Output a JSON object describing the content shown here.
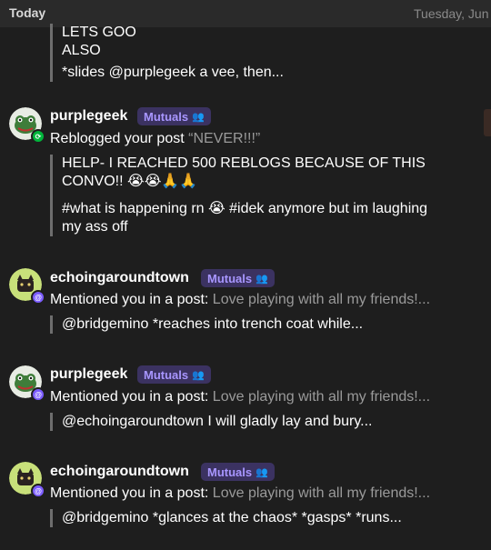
{
  "header": {
    "today_label": "Today",
    "date_label": "Tuesday, Jun"
  },
  "top_quote": {
    "lines": [
      "LETS GOO",
      "ALSO",
      "*slides @purplegeek a vee, then..."
    ]
  },
  "notifications": [
    {
      "username": "purplegeek",
      "badge": "Mutuals",
      "action": "Reblogged your post",
      "post_title": "“NEVER!!!”",
      "quote_lines": [
        "HELP- I REACHED 500 REBLOGS BECAUSE OF THIS",
        "CONVO!! 😭😭🙏🙏",
        "#what is happening rn 😭 #idek anymore but im laughing",
        "my ass off"
      ],
      "avatar_type": "reblog"
    },
    {
      "username": "echoingaroundtown",
      "badge": "Mutuals",
      "action": "Mentioned you in a post:",
      "post_title": "Love playing with all my friends!...",
      "quote_lines": [
        "@bridgemino *reaches into trench coat while..."
      ],
      "avatar_type": "mention"
    },
    {
      "username": "purplegeek",
      "badge": "Mutuals",
      "action": "Mentioned you in a post:",
      "post_title": "Love playing with all my friends!...",
      "quote_lines": [
        "@echoingaroundtown I will gladly lay and bury..."
      ],
      "avatar_type": "mention"
    },
    {
      "username": "echoingaroundtown",
      "badge": "Mutuals",
      "action": "Mentioned you in a post:",
      "post_title": "Love playing with all my friends!...",
      "quote_lines": [
        "@bridgemino *glances at the chaos* *gasps* *runs..."
      ],
      "avatar_type": "mention"
    }
  ],
  "icons": {
    "mutuals": "people-icon",
    "reblog": "reblog-icon",
    "mention": "at-icon"
  },
  "colors": {
    "background": "#1e1e1e",
    "pill_bg": "#3b3261",
    "pill_text": "#a896ff",
    "reblog_green": "#00b53b",
    "mention_purple": "#7b5cff"
  }
}
